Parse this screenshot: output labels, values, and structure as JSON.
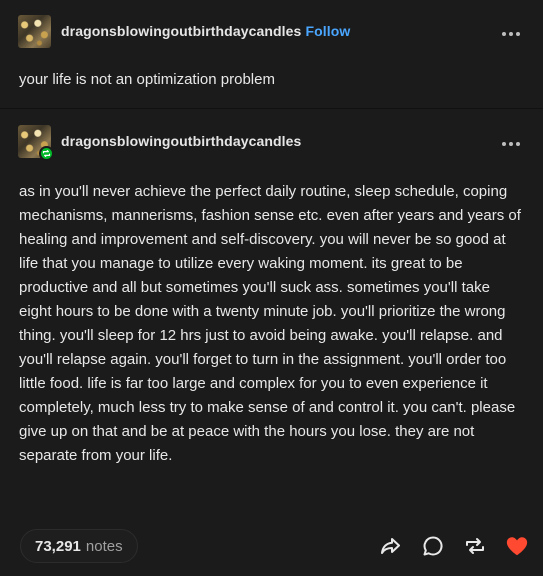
{
  "op": {
    "username": "dragonsblowingoutbirthdaycandles",
    "follow_label": "Follow",
    "text": "your life is not an optimization problem"
  },
  "reblog": {
    "username": "dragonsblowingoutbirthdaycandles",
    "text": "as in you'll never achieve the perfect daily routine, sleep schedule, coping mechanisms, mannerisms, fashion sense etc. even after years and years of healing and improvement and self-discovery. you will never be so good at life that you manage to utilize every waking moment. its great to be productive and all but sometimes you'll suck ass. sometimes you'll take eight hours to be done with a twenty minute job. you'll prioritize the wrong thing. you'll sleep for 12 hrs just to avoid being awake. you'll relapse. and you'll relapse again. you'll forget to turn in the assignment. you'll order too little food. life is far too large and complex for you to even experience it completely, much less try to make sense of and control it. you can't. please give up on that and be at peace with the hours you lose. they are not separate from your life."
  },
  "footer": {
    "notes_count": "73,291",
    "notes_label": "notes"
  },
  "icons": {
    "more": "more-horizontal-icon",
    "share": "share-icon",
    "reply": "reply-icon",
    "reblog": "reblog-icon",
    "like": "heart-icon"
  },
  "colors": {
    "background": "#1b1b1b",
    "follow": "#4aa6ff",
    "like": "#ff4930",
    "reblog_badge": "#00b929"
  }
}
